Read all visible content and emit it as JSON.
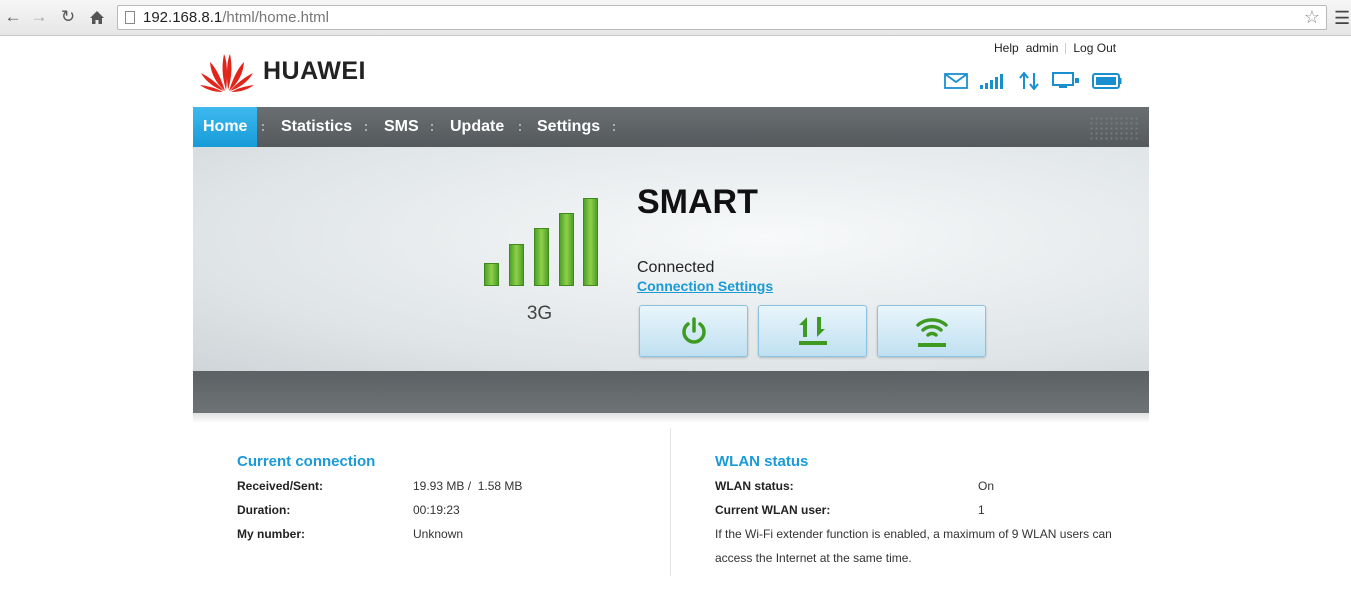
{
  "browser": {
    "url_host": "192.168.8.1",
    "url_path": "/html/home.html"
  },
  "header": {
    "brand": "HUAWEI",
    "links": {
      "help": "Help",
      "user": "admin",
      "logout": "Log Out"
    },
    "status_icons": [
      "mail-icon",
      "signal-icon",
      "data-transfer-icon",
      "pc-connection-icon",
      "battery-icon"
    ]
  },
  "nav": {
    "items": [
      {
        "label": "Home",
        "active": true
      },
      {
        "label": "Statistics",
        "active": false
      },
      {
        "label": "SMS",
        "active": false
      },
      {
        "label": "Update",
        "active": false
      },
      {
        "label": "Settings",
        "active": false
      }
    ]
  },
  "hero": {
    "signal_level": 5,
    "signal_max": 5,
    "network_type": "3G",
    "operator": "SMART",
    "status": "Connected",
    "settings_link": "Connection Settings",
    "buttons": [
      "power-icon",
      "upload-download-icon",
      "wifi-icon"
    ],
    "colors": {
      "accent": "#1a9ad6",
      "signal": "#6cbf36"
    }
  },
  "current_connection": {
    "title": "Current connection",
    "rows": [
      {
        "label": "Received/Sent:",
        "value": "19.93 MB /  1.58 MB"
      },
      {
        "label": "Duration:",
        "value": "00:19:23"
      },
      {
        "label": "My number:",
        "value": "Unknown"
      }
    ]
  },
  "wlan": {
    "title": "WLAN status",
    "rows": [
      {
        "label": "WLAN status:",
        "value": "On"
      },
      {
        "label": "Current WLAN user:",
        "value": "1"
      }
    ],
    "note": "If the Wi-Fi extender function is enabled, a maximum of 9 WLAN users can access the Internet at the same time."
  }
}
